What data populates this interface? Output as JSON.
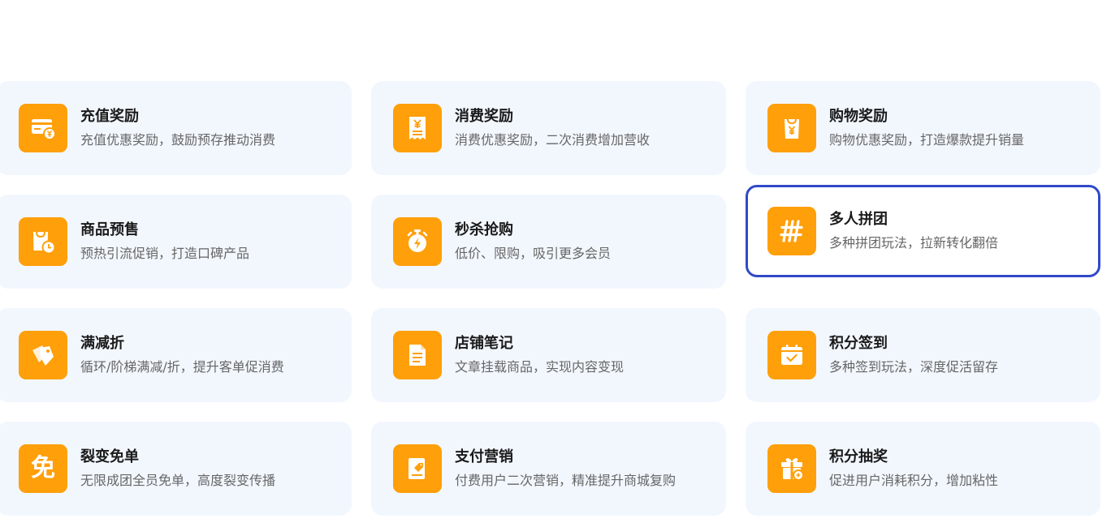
{
  "colors": {
    "accent": "#ff9f0a",
    "card_bg": "#f2f7fe",
    "active_border": "#3049c9"
  },
  "cards": [
    {
      "title": "充值奖励",
      "desc": "充值优惠奖励，鼓励预存推动消费",
      "icon": "recharge-card-icon"
    },
    {
      "title": "消费奖励",
      "desc": "消费优惠奖励，二次消费增加营收",
      "icon": "receipt-yen-icon"
    },
    {
      "title": "购物奖励",
      "desc": "购物优惠奖励，打造爆款提升销量",
      "icon": "shopping-bag-yen-icon"
    },
    {
      "title": "商品预售",
      "desc": "预热引流促销，打造口碑产品",
      "icon": "bag-clock-icon"
    },
    {
      "title": "秒杀抢购",
      "desc": "低价、限购，吸引更多会员",
      "icon": "stopwatch-bolt-icon"
    },
    {
      "title": "多人拼团",
      "desc": "多种拼团玩法，拉新转化翻倍",
      "icon": "group-hash-icon"
    },
    {
      "title": "满减折",
      "desc": "循环/阶梯满减/折，提升客单促消费",
      "icon": "discount-tags-icon"
    },
    {
      "title": "店铺笔记",
      "desc": "文章挂载商品，实现内容变现",
      "icon": "note-document-icon"
    },
    {
      "title": "积分签到",
      "desc": "多种签到玩法，深度促活留存",
      "icon": "calendar-check-icon"
    },
    {
      "title": "裂变免单",
      "desc": "无限成团全员免单，高度裂变传播",
      "icon": "free-order-icon"
    },
    {
      "title": "支付营销",
      "desc": "付费用户二次营销，精准提升商城复购",
      "icon": "payment-tag-icon"
    },
    {
      "title": "积分抽奖",
      "desc": "促进用户消耗积分，增加粘性",
      "icon": "gift-box-icon"
    }
  ],
  "free_glyph": "免"
}
